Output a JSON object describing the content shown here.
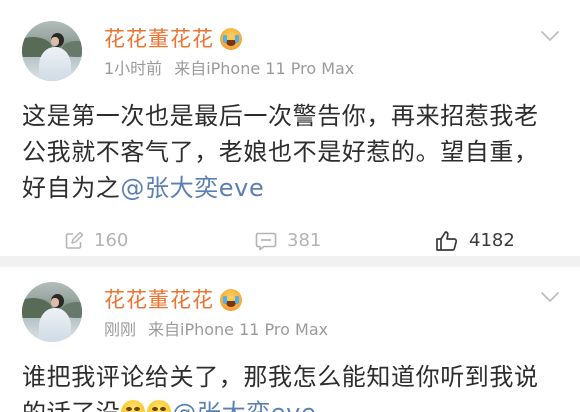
{
  "colors": {
    "name": "#ec7330",
    "meta": "#9b9b9b",
    "body": "#2d2d2d",
    "mention": "#5b7fb2",
    "action": "#b3b3b3",
    "like": "#3a3a3a",
    "divider": "#f1f1f1",
    "chevron": "#bcbcbc"
  },
  "posts": [
    {
      "author": {
        "name": "花花董花花",
        "name_badge_icon": "crying-face"
      },
      "time": "1小时前",
      "source": "来自iPhone 11 Pro Max",
      "menu_icon": "chevron-down",
      "body": {
        "lines": [
          "这是第一次也是最后一次警告你，再来招惹我老",
          "公我就不客气了，老娘也不是好惹的。望自重，",
          "好自为之"
        ],
        "mention": "@张大奕eve"
      },
      "actions": {
        "repost": {
          "icon": "repost",
          "count": 160
        },
        "comment": {
          "icon": "comment",
          "count": 381
        },
        "like": {
          "icon": "thumbs-up",
          "count": 4182
        }
      }
    },
    {
      "author": {
        "name": "花花董花花",
        "name_badge_icon": "crying-face"
      },
      "time": "刚刚",
      "source": "来自iPhone 11 Pro Max",
      "menu_icon": "chevron-down",
      "body": {
        "lines": [
          "谁把我评论给关了，那我怎么能知道你听到我说",
          "的话了没"
        ],
        "emojis": [
          "laughing-tears",
          "laughing-tears"
        ],
        "mention": "@张大奕eve"
      }
    }
  ]
}
